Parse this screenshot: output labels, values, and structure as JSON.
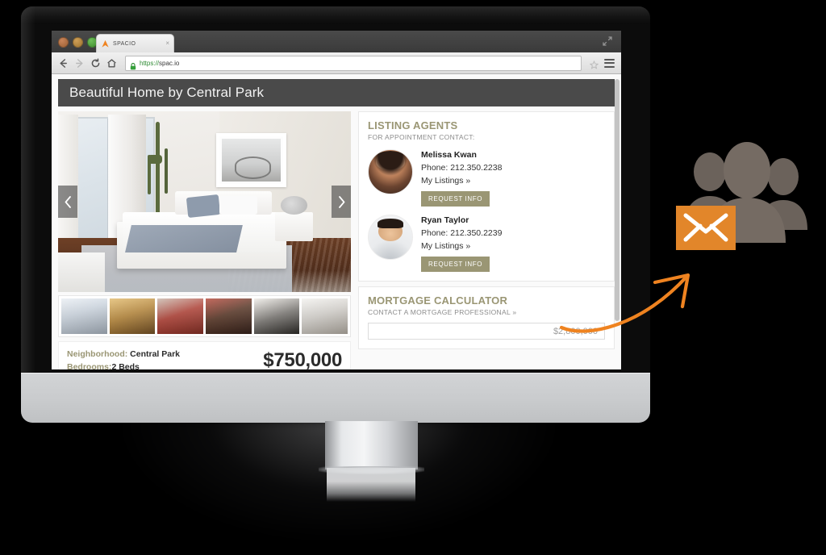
{
  "browser": {
    "tab_title": "SPACIO",
    "tab_close": "×",
    "url_scheme": "https://",
    "url_host": "spac.io",
    "icons": {
      "back": "back-arrow-icon",
      "forward": "forward-arrow-icon",
      "reload": "reload-icon",
      "home": "home-icon",
      "lock": "lock-icon",
      "bookmark": "star-icon",
      "menu": "hamburger-menu-icon",
      "maximize": "maximize-icon"
    }
  },
  "page": {
    "header_title": "Beautiful Home by Central Park",
    "gallery": {
      "prev_label": "‹",
      "next_label": "›",
      "thumb_count": 6
    },
    "facts": {
      "neighborhood_label": "Neighborhood:",
      "neighborhood_value": "Central Park",
      "bedrooms_label": "Bedrooms:",
      "bedrooms_value": "2 Beds",
      "price": "$750,000"
    },
    "listing_agents": {
      "title": "LISTING AGENTS",
      "subtitle": "FOR APPOINTMENT CONTACT:",
      "agents": [
        {
          "name": "Melissa Kwan",
          "phone": "Phone: 212.350.2238",
          "listings_link": "My Listings »",
          "button": "REQUEST INFO"
        },
        {
          "name": "Ryan Taylor",
          "phone": "Phone: 212.350.2239",
          "listings_link": "My Listings »",
          "button": "REQUEST INFO"
        }
      ]
    },
    "mortgage": {
      "title": "MORTGAGE CALCULATOR",
      "subtitle": "CONTACT A MORTGAGE PROFESSIONAL »",
      "amount_value": "$2,800,000"
    }
  },
  "graphic": {
    "people_icon": "group-of-people-icon",
    "envelope_icon": "envelope-icon",
    "arrow_icon": "curved-arrow-icon"
  },
  "colors": {
    "accent_olive": "#9a9674",
    "accent_orange": "#e2862a",
    "header_dark": "#4a4a4a",
    "people_gray": "#6b625b"
  }
}
